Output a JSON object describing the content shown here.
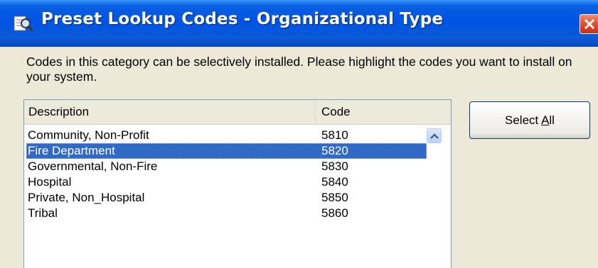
{
  "window": {
    "title": "Preset Lookup Codes - Organizational Type",
    "title_icon": "lookup-magnifier-icon",
    "close_icon": "close-icon"
  },
  "instructions": "Codes in this category can be selectively installed. Please highlight the codes you want to install on your system.",
  "list": {
    "headers": {
      "description": "Description",
      "code": "Code"
    },
    "rows": [
      {
        "description": "Community, Non-Profit",
        "code": "5810",
        "selected": false
      },
      {
        "description": "Fire Department",
        "code": "5820",
        "selected": true
      },
      {
        "description": "Governmental, Non-Fire",
        "code": "5830",
        "selected": false
      },
      {
        "description": "Hospital",
        "code": "5840",
        "selected": false
      },
      {
        "description": "Private, Non_Hospital",
        "code": "5850",
        "selected": false
      },
      {
        "description": "Tribal",
        "code": "5860",
        "selected": false
      }
    ],
    "scroll_icon": "chevron-up-icon"
  },
  "buttons": {
    "select_all_prefix": "Select ",
    "select_all_mnemonic": "A",
    "select_all_suffix": "ll"
  },
  "colors": {
    "titlebar": "#0054e3",
    "selection": "#316ac5",
    "dialog_bg": "#ece9d8",
    "close_button": "#e0431f"
  }
}
